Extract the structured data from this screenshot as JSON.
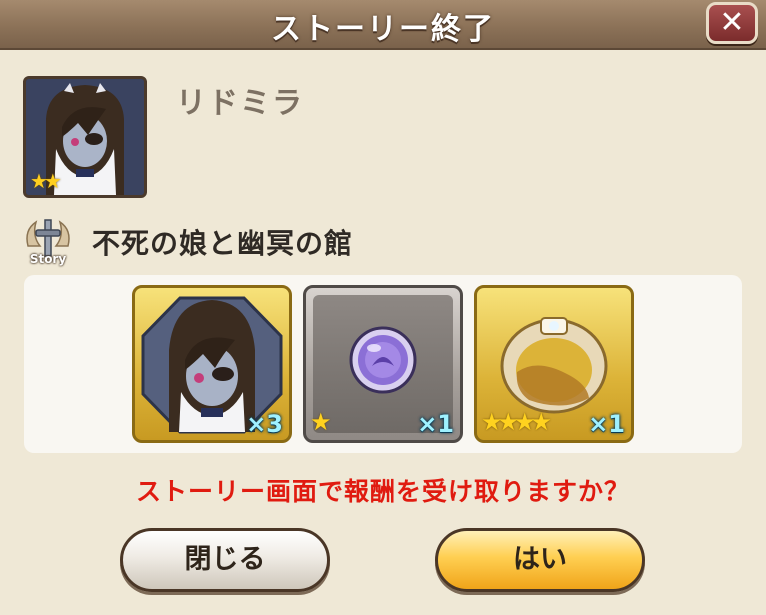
{
  "dialog": {
    "title": "ストーリー終了",
    "close_icon": "close-x-icon",
    "close_glyph": "✕"
  },
  "character": {
    "name": "リドミラ",
    "rarity_stars": "★★",
    "portrait": "pale-girl-long-brown-hair-eyepatch"
  },
  "story": {
    "emblem_icon": "story-sword-emblem",
    "emblem_label": "Story",
    "title": "不死の娘と幽冥の館"
  },
  "rewards": [
    {
      "icon": "character-portrait-icon",
      "quantity": "×3",
      "stars": ""
    },
    {
      "icon": "purple-orb-icon",
      "quantity": "×1",
      "stars": "★"
    },
    {
      "icon": "gold-ring-icon",
      "quantity": "×1",
      "stars": "★★★★"
    }
  ],
  "prompt": "ストーリー画面で報酬を受け取りますか？",
  "buttons": {
    "close_label": "閉じる",
    "yes_label": "はい"
  },
  "colors": {
    "header": "#8c7258",
    "background": "#efe8d6",
    "prompt": "#e01b10",
    "close_button": "#7b2c2c",
    "yes_button": "#ffcf52"
  }
}
